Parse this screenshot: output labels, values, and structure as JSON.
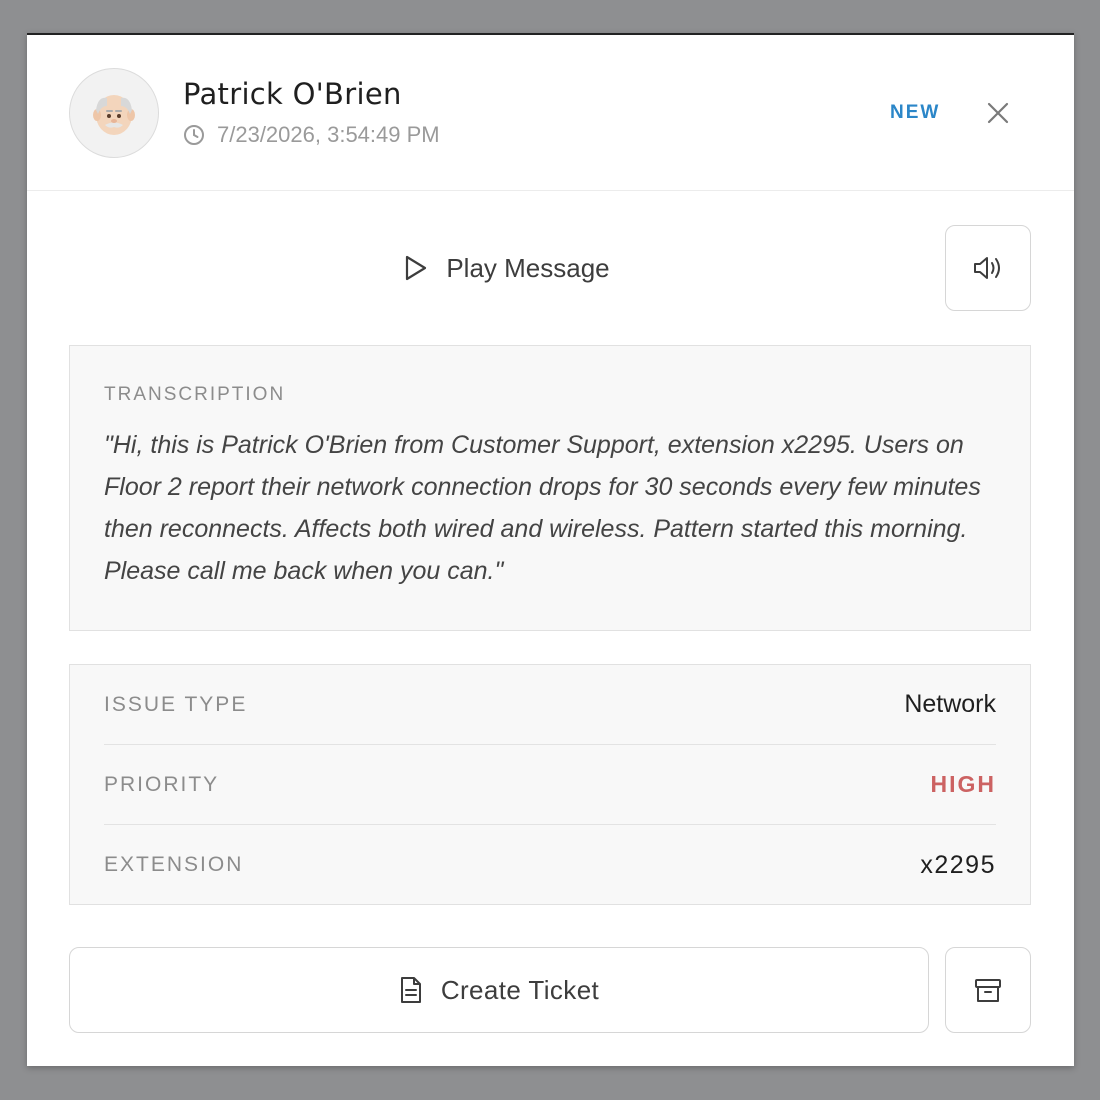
{
  "caller": {
    "name": "Patrick O'Brien",
    "timestamp": "7/23/2026, 3:54:49 PM",
    "avatar_icon": "old-man-emoji"
  },
  "status": {
    "badge": "NEW",
    "color": "#2b86c8"
  },
  "player": {
    "play_label": "Play Message",
    "play_icon": "play-icon",
    "volume_icon": "volume-icon"
  },
  "transcription": {
    "label": "TRANSCRIPTION",
    "text": "\"Hi, this is Patrick O'Brien from Customer Support, extension x2295. Users on Floor 2 report their network connection drops for 30 seconds every few minutes then reconnects. Affects both wired and wireless. Pattern started this morning. Please call me back when you can.\""
  },
  "details": [
    {
      "key": "ISSUE TYPE",
      "value": "Network"
    },
    {
      "key": "PRIORITY",
      "value": "HIGH",
      "color": "#cc6262"
    },
    {
      "key": "EXTENSION",
      "value": "x2295"
    }
  ],
  "actions": {
    "create_label": "Create Ticket",
    "create_icon": "document-icon",
    "archive_icon": "archive-icon"
  }
}
